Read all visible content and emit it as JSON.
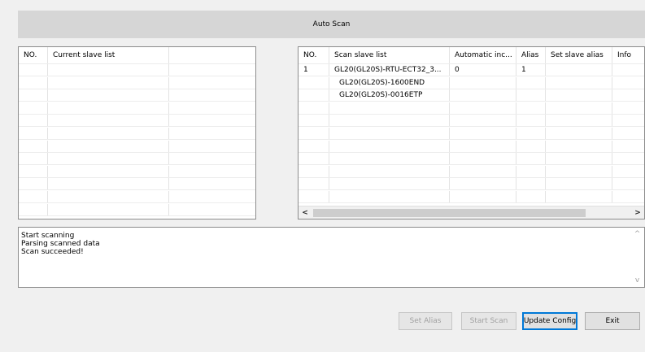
{
  "header": {
    "title": "Auto Scan"
  },
  "left_table": {
    "columns": [
      "NO.",
      "Current slave list",
      ""
    ],
    "rows": []
  },
  "right_table": {
    "columns": [
      "NO.",
      "Scan slave list",
      "Automatic inc...",
      "Alias",
      "Set slave alias",
      "Info"
    ],
    "rows": [
      {
        "no": "1",
        "name": "GL20(GL20S)-RTU-ECT32_3...",
        "auto": "0",
        "alias": "1",
        "set_alias": "",
        "info": ""
      },
      {
        "no": "",
        "name": "GL20(GL20S)-1600END",
        "auto": "",
        "alias": "",
        "set_alias": "",
        "info": ""
      },
      {
        "no": "",
        "name": "GL20(GL20S)-0016ETP",
        "auto": "",
        "alias": "",
        "set_alias": "",
        "info": ""
      }
    ],
    "scroll_left": "<",
    "scroll_right": ">"
  },
  "log": {
    "lines": [
      "Start scanning",
      "Parsing scanned data",
      "Scan succeeded!"
    ],
    "scroll_up": "^",
    "scroll_down": "v"
  },
  "buttons": {
    "set_alias": "Set Alias",
    "start_scan": "Start Scan",
    "update_config": "Update Config",
    "exit": "Exit"
  }
}
